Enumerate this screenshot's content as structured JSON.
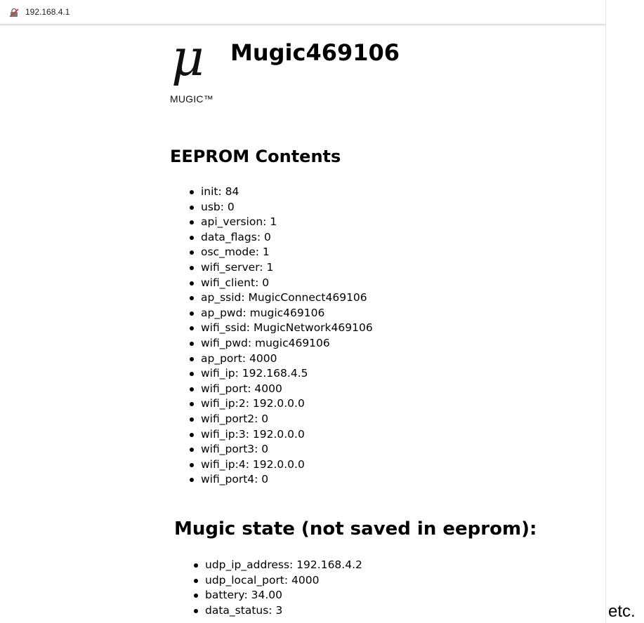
{
  "browser": {
    "url": "192.168.4.1",
    "security_icon": "not-secure-icon"
  },
  "header": {
    "logo_symbol": "μ",
    "logo_text": "MUGIC™",
    "device_name": "Mugic469106"
  },
  "eeprom": {
    "heading": "EEPROM Contents",
    "items": [
      "init: 84",
      "usb: 0",
      "api_version: 1",
      "data_flags: 0",
      "osc_mode: 1",
      "wifi_server: 1",
      "wifi_client: 0",
      "ap_ssid: MugicConnect469106",
      "ap_pwd: mugic469106",
      "wifi_ssid: MugicNetwork469106",
      "wifi_pwd: mugic469106",
      "ap_port: 4000",
      "wifi_ip: 192.168.4.5",
      "wifi_port: 4000",
      "wifi_ip:2: 192.0.0.0",
      "wifi_port2: 0",
      "wifi_ip:3: 192.0.0.0",
      "wifi_port3: 0",
      "wifi_ip:4: 192.0.0.0",
      "wifi_port4: 0"
    ]
  },
  "state": {
    "heading": "Mugic state (not saved in eeprom):",
    "items": [
      "udp_ip_address: 192.168.4.2",
      "udp_local_port: 4000",
      "battery: 34.00",
      "data_status: 3"
    ]
  },
  "annotation": {
    "etc": "etc."
  }
}
